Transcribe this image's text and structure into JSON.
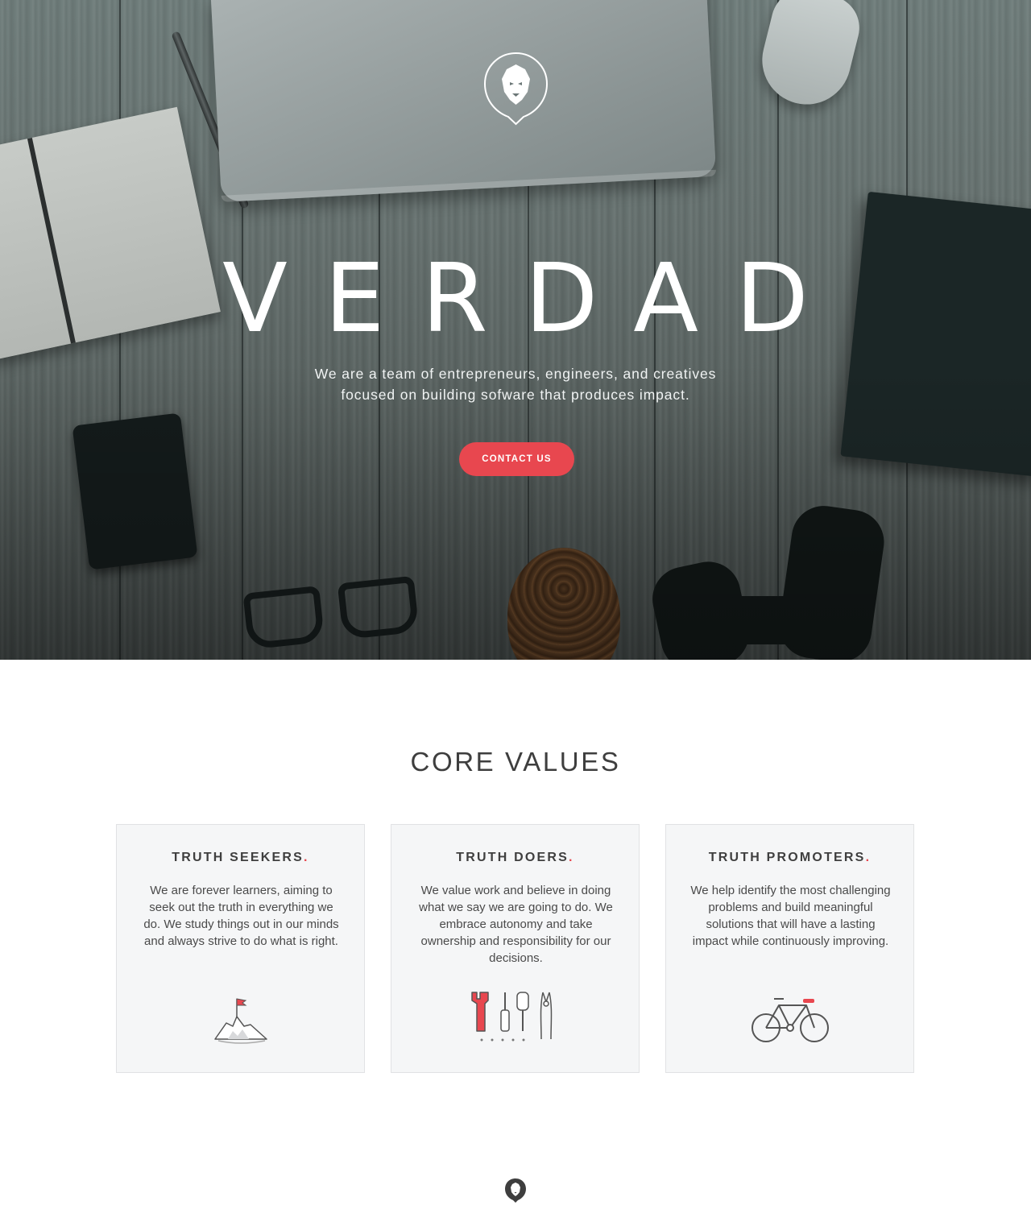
{
  "hero": {
    "title": "VERDAD",
    "tagline_line1": "We are a team of entrepreneurs, engineers, and creatives",
    "tagline_line2": "focused on building sofware that produces impact.",
    "cta_label": "CONTACT US",
    "logo_icon": "lion-head-icon"
  },
  "core_values": {
    "title": "CORE VALUES",
    "cards": [
      {
        "title": "TRUTH SEEKERS",
        "accent": ".",
        "text": "We are forever learners, aiming to seek out the truth in everything we do. We study things out in our minds and always strive to do what is right.",
        "icon": "mountain-flag-icon"
      },
      {
        "title": "TRUTH DOERS",
        "accent": ".",
        "text": "We value work and believe in doing what we say we are going to do. We embrace autonomy and take ownership and responsibility for our decisions.",
        "icon": "tools-icon"
      },
      {
        "title": "TRUTH PROMOTERS",
        "accent": ".",
        "text": "We help identify the most challenging problems and build meaningful solutions that will have a lasting impact while continuously improving.",
        "icon": "bicycle-icon"
      }
    ]
  },
  "footer": {
    "logo_icon": "lion-head-icon"
  },
  "colors": {
    "accent": "#e8474f",
    "heading": "#3e3e3e",
    "card_bg": "#f5f6f7",
    "card_border": "#e1e2e4"
  }
}
